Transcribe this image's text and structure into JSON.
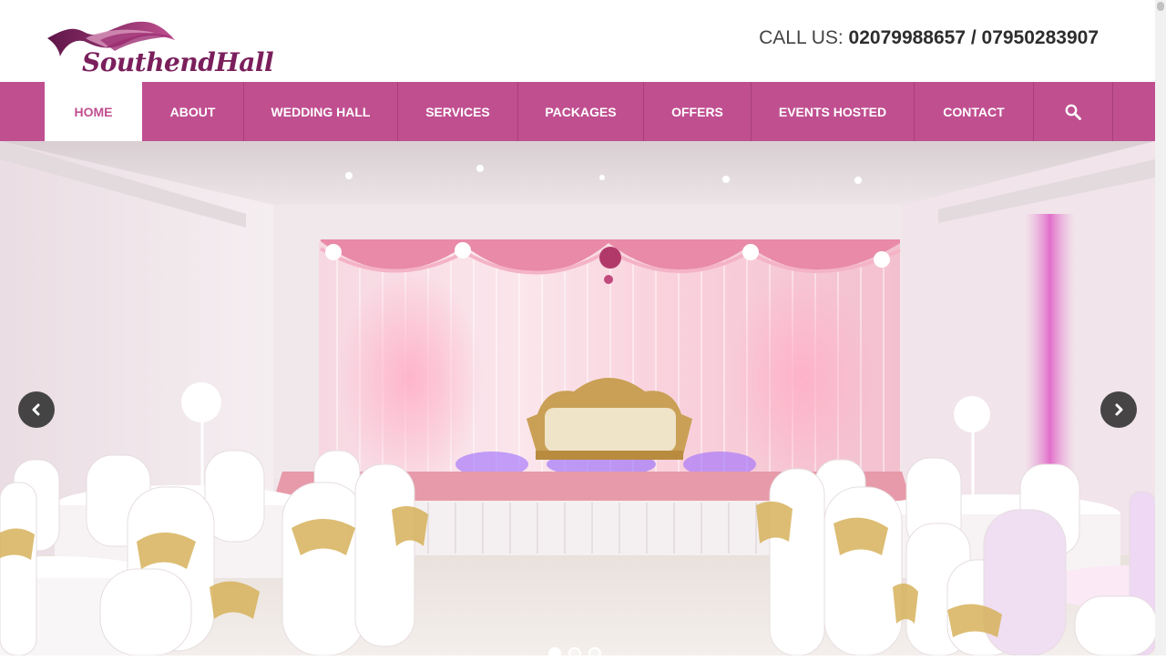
{
  "brand": {
    "name": "SouthendHall"
  },
  "header": {
    "call_label": "CALL US:",
    "phones": "02079988657 / 07950283907"
  },
  "nav": {
    "items": [
      {
        "label": "HOME",
        "active": true
      },
      {
        "label": "ABOUT"
      },
      {
        "label": "WEDDING HALL"
      },
      {
        "label": "SERVICES"
      },
      {
        "label": "PACKAGES"
      },
      {
        "label": "OFFERS"
      },
      {
        "label": "EVENTS HOSTED"
      },
      {
        "label": "CONTACT"
      }
    ],
    "search_icon": "search-icon"
  },
  "slider": {
    "slide_count": 3,
    "active_index": 0,
    "prev_icon": "chevron-left-icon",
    "next_icon": "chevron-right-icon"
  },
  "colors": {
    "brand": "#c04f90",
    "logo": "#7a1f5c"
  }
}
